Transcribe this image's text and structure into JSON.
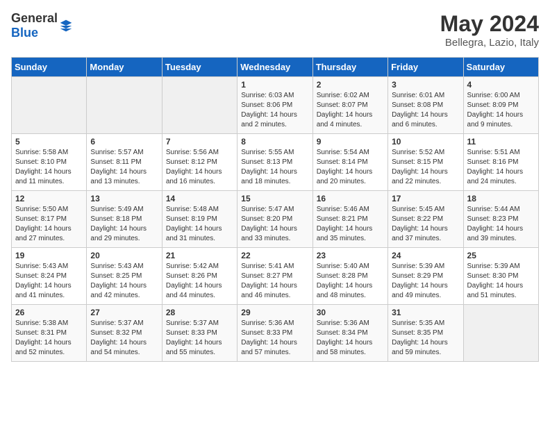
{
  "header": {
    "logo_general": "General",
    "logo_blue": "Blue",
    "month": "May 2024",
    "location": "Bellegra, Lazio, Italy"
  },
  "days_of_week": [
    "Sunday",
    "Monday",
    "Tuesday",
    "Wednesday",
    "Thursday",
    "Friday",
    "Saturday"
  ],
  "weeks": [
    [
      {
        "day": "",
        "empty": true
      },
      {
        "day": "",
        "empty": true
      },
      {
        "day": "",
        "empty": true
      },
      {
        "day": "1",
        "sunrise": "6:03 AM",
        "sunset": "8:06 PM",
        "daylight": "14 hours and 2 minutes."
      },
      {
        "day": "2",
        "sunrise": "6:02 AM",
        "sunset": "8:07 PM",
        "daylight": "14 hours and 4 minutes."
      },
      {
        "day": "3",
        "sunrise": "6:01 AM",
        "sunset": "8:08 PM",
        "daylight": "14 hours and 6 minutes."
      },
      {
        "day": "4",
        "sunrise": "6:00 AM",
        "sunset": "8:09 PM",
        "daylight": "14 hours and 9 minutes."
      }
    ],
    [
      {
        "day": "5",
        "sunrise": "5:58 AM",
        "sunset": "8:10 PM",
        "daylight": "14 hours and 11 minutes."
      },
      {
        "day": "6",
        "sunrise": "5:57 AM",
        "sunset": "8:11 PM",
        "daylight": "14 hours and 13 minutes."
      },
      {
        "day": "7",
        "sunrise": "5:56 AM",
        "sunset": "8:12 PM",
        "daylight": "14 hours and 16 minutes."
      },
      {
        "day": "8",
        "sunrise": "5:55 AM",
        "sunset": "8:13 PM",
        "daylight": "14 hours and 18 minutes."
      },
      {
        "day": "9",
        "sunrise": "5:54 AM",
        "sunset": "8:14 PM",
        "daylight": "14 hours and 20 minutes."
      },
      {
        "day": "10",
        "sunrise": "5:52 AM",
        "sunset": "8:15 PM",
        "daylight": "14 hours and 22 minutes."
      },
      {
        "day": "11",
        "sunrise": "5:51 AM",
        "sunset": "8:16 PM",
        "daylight": "14 hours and 24 minutes."
      }
    ],
    [
      {
        "day": "12",
        "sunrise": "5:50 AM",
        "sunset": "8:17 PM",
        "daylight": "14 hours and 27 minutes."
      },
      {
        "day": "13",
        "sunrise": "5:49 AM",
        "sunset": "8:18 PM",
        "daylight": "14 hours and 29 minutes."
      },
      {
        "day": "14",
        "sunrise": "5:48 AM",
        "sunset": "8:19 PM",
        "daylight": "14 hours and 31 minutes."
      },
      {
        "day": "15",
        "sunrise": "5:47 AM",
        "sunset": "8:20 PM",
        "daylight": "14 hours and 33 minutes."
      },
      {
        "day": "16",
        "sunrise": "5:46 AM",
        "sunset": "8:21 PM",
        "daylight": "14 hours and 35 minutes."
      },
      {
        "day": "17",
        "sunrise": "5:45 AM",
        "sunset": "8:22 PM",
        "daylight": "14 hours and 37 minutes."
      },
      {
        "day": "18",
        "sunrise": "5:44 AM",
        "sunset": "8:23 PM",
        "daylight": "14 hours and 39 minutes."
      }
    ],
    [
      {
        "day": "19",
        "sunrise": "5:43 AM",
        "sunset": "8:24 PM",
        "daylight": "14 hours and 41 minutes."
      },
      {
        "day": "20",
        "sunrise": "5:43 AM",
        "sunset": "8:25 PM",
        "daylight": "14 hours and 42 minutes."
      },
      {
        "day": "21",
        "sunrise": "5:42 AM",
        "sunset": "8:26 PM",
        "daylight": "14 hours and 44 minutes."
      },
      {
        "day": "22",
        "sunrise": "5:41 AM",
        "sunset": "8:27 PM",
        "daylight": "14 hours and 46 minutes."
      },
      {
        "day": "23",
        "sunrise": "5:40 AM",
        "sunset": "8:28 PM",
        "daylight": "14 hours and 48 minutes."
      },
      {
        "day": "24",
        "sunrise": "5:39 AM",
        "sunset": "8:29 PM",
        "daylight": "14 hours and 49 minutes."
      },
      {
        "day": "25",
        "sunrise": "5:39 AM",
        "sunset": "8:30 PM",
        "daylight": "14 hours and 51 minutes."
      }
    ],
    [
      {
        "day": "26",
        "sunrise": "5:38 AM",
        "sunset": "8:31 PM",
        "daylight": "14 hours and 52 minutes."
      },
      {
        "day": "27",
        "sunrise": "5:37 AM",
        "sunset": "8:32 PM",
        "daylight": "14 hours and 54 minutes."
      },
      {
        "day": "28",
        "sunrise": "5:37 AM",
        "sunset": "8:33 PM",
        "daylight": "14 hours and 55 minutes."
      },
      {
        "day": "29",
        "sunrise": "5:36 AM",
        "sunset": "8:33 PM",
        "daylight": "14 hours and 57 minutes."
      },
      {
        "day": "30",
        "sunrise": "5:36 AM",
        "sunset": "8:34 PM",
        "daylight": "14 hours and 58 minutes."
      },
      {
        "day": "31",
        "sunrise": "5:35 AM",
        "sunset": "8:35 PM",
        "daylight": "14 hours and 59 minutes."
      },
      {
        "day": "",
        "empty": true
      }
    ]
  ]
}
